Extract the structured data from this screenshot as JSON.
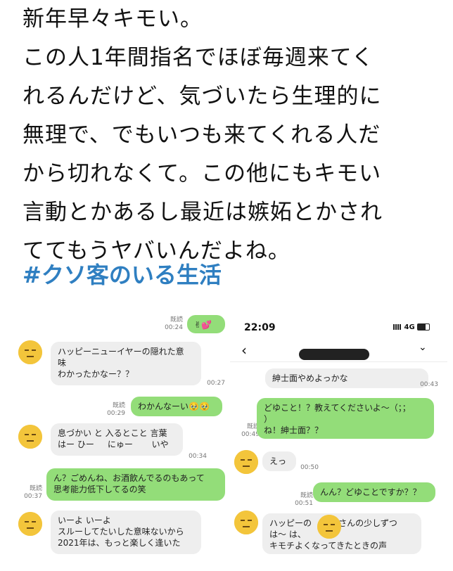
{
  "tweet": {
    "lines": [
      "新年早々キモい。",
      "この人1年間指名でほぼ毎週来てく",
      "れるんだけど、気づいたら生理的に",
      "無理で、でもいつも来てくれる人だ",
      "から切れなくて。この他にもキモい",
      "言動とかあるし最近は嫉妬とかされ",
      "ててもうヤバいんだよね。"
    ],
    "hashtag": "#クソ客のいる生活"
  },
  "left_chat": {
    "m1": {
      "read": "既読",
      "time": "00:24",
      "text": "✌💕"
    },
    "m2": {
      "text": "ハッピーニューイヤーの隠れた意\n味\nわかったかなー？？",
      "time": "00:27"
    },
    "m3": {
      "read": "既読",
      "time": "00:29",
      "text": "わかんなーい🥹🥹"
    },
    "m4": {
      "text": "息づかい と 入るとこと 言葉\nはー ひー     にゅー       いや",
      "time": "00:34"
    },
    "m5": {
      "read": "既読",
      "time": "00:37",
      "text": "ん？ごめんね、お酒飲んでるのもあって\n思考能力低下してるの笑"
    },
    "m6": {
      "text": "いーよ いーよ\nスルーしてたいした意味ないから\n2021年は、もっと楽しく逢いた"
    }
  },
  "right_chat": {
    "status_time": "22:09",
    "network": "4G",
    "r1": {
      "text": "紳士面やめよっかな",
      "time": "00:43"
    },
    "r2": {
      "read": "既読",
      "time": "00:49",
      "text": "どゆこと！？教えてくださいよ～（；；\n）\nね！紳士面？？"
    },
    "r3": {
      "text": "えっ",
      "time": "00:50"
    },
    "r4": {
      "read": "既読",
      "time": "00:51",
      "text": "んん？どゆことですか？？"
    },
    "r5": {
      "text": "ハッピーの          さんの少しずつ\nは～ は、\nキモチよくなってきたときの声"
    }
  },
  "colors": {
    "hashtag": "#2f7fc1",
    "outgoing": "#93dd79",
    "incoming": "#eeeeee",
    "avatar": "#f3c53b"
  }
}
